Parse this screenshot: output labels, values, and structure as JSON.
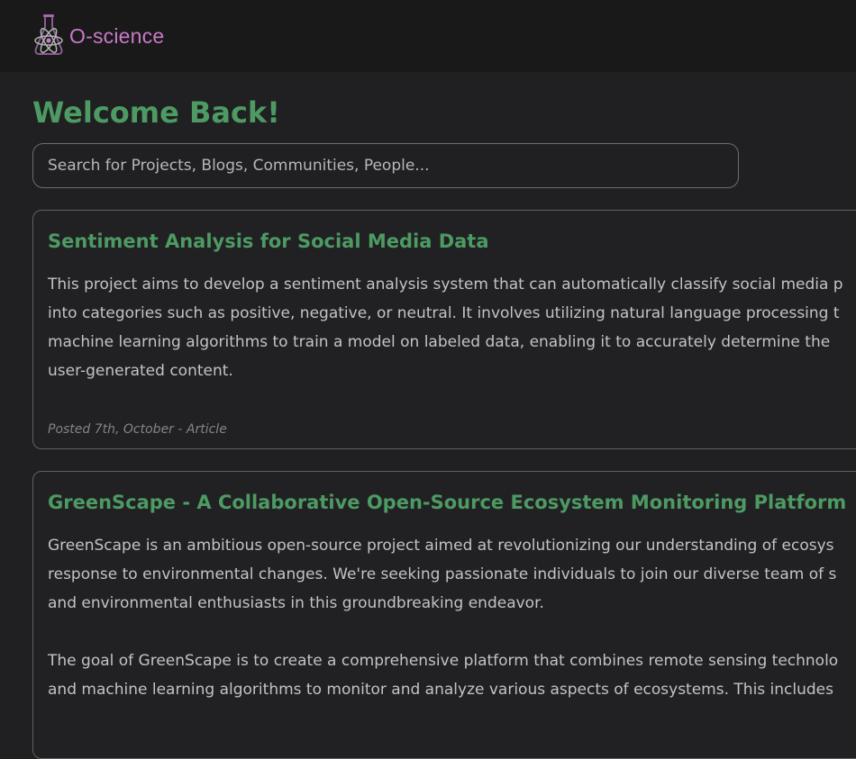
{
  "header": {
    "logo_text": "O-science"
  },
  "main": {
    "welcome": "Welcome Back!",
    "search": {
      "placeholder": "Search for Projects, Blogs, Communities, People..."
    },
    "posts": [
      {
        "title": "Sentiment Analysis for Social Media Data",
        "lines": [
          "This project aims to develop a sentiment analysis system that can automatically classify social media p",
          "into categories such as positive, negative, or neutral. It involves utilizing natural language processing t",
          "machine learning algorithms to train a model on labeled data, enabling it to accurately determine the",
          "user-generated content."
        ],
        "meta": "Posted 7th, October - Article"
      },
      {
        "title": "GreenScape - A Collaborative Open-Source Ecosystem Monitoring Platform",
        "lines": [
          "GreenScape is an ambitious open-source project aimed at revolutionizing our understanding of ecosys",
          "response to environmental changes. We're seeking passionate individuals to join our diverse team of s",
          "and environmental enthusiasts in this groundbreaking endeavor.",
          "The goal of GreenScape is to create a comprehensive platform that combines remote sensing technolo",
          "and machine learning algorithms to monitor and analyze various aspects of ecosystems. This includes"
        ]
      }
    ]
  }
}
